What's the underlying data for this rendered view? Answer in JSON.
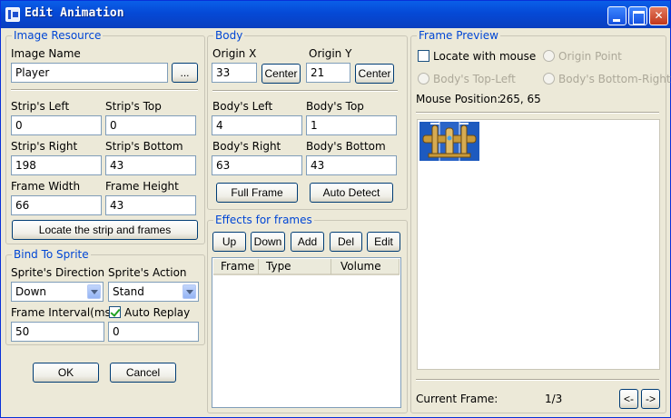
{
  "window": {
    "title": "Edit Animation"
  },
  "image_resource": {
    "group_label": "Image Resource",
    "image_name_label": "Image Name",
    "image_name_value": "Player",
    "browse_label": "...",
    "strip_left_label": "Strip's Left",
    "strip_left_value": "0",
    "strip_top_label": "Strip's Top",
    "strip_top_value": "0",
    "strip_right_label": "Strip's Right",
    "strip_right_value": "198",
    "strip_bottom_label": "Strip's Bottom",
    "strip_bottom_value": "43",
    "frame_width_label": "Frame Width",
    "frame_width_value": "66",
    "frame_height_label": "Frame Height",
    "frame_height_value": "43",
    "locate_button": "Locate the strip and frames"
  },
  "bind_to_sprite": {
    "group_label": "Bind To Sprite",
    "direction_label": "Sprite's Direction",
    "direction_value": "Down",
    "action_label": "Sprite's Action",
    "action_value": "Stand",
    "interval_label": "Frame Interval(ms)",
    "interval_value": "50",
    "auto_replay_label": "Auto Replay",
    "auto_replay_checked": true,
    "auto_replay_value": "0"
  },
  "dialog_buttons": {
    "ok": "OK",
    "cancel": "Cancel"
  },
  "body": {
    "group_label": "Body",
    "origin_x_label": "Origin X",
    "origin_x_value": "33",
    "origin_y_label": "Origin Y",
    "origin_y_value": "21",
    "center_label": "Center",
    "body_left_label": "Body's Left",
    "body_left_value": "4",
    "body_top_label": "Body's Top",
    "body_top_value": "1",
    "body_right_label": "Body's Right",
    "body_right_value": "63",
    "body_bottom_label": "Body's Bottom",
    "body_bottom_value": "43",
    "full_frame_button": "Full Frame",
    "auto_detect_button": "Auto Detect"
  },
  "effects": {
    "group_label": "Effects for frames",
    "buttons": {
      "up": "Up",
      "down": "Down",
      "add": "Add",
      "del": "Del",
      "edit": "Edit"
    },
    "columns": [
      "Frame",
      "Type",
      "Volume"
    ]
  },
  "frame_preview": {
    "group_label": "Frame Preview",
    "locate_with_mouse_label": "Locate with mouse",
    "origin_point_label": "Origin Point",
    "body_top_left_label": "Body's Top-Left",
    "body_bottom_right_label": "Body's Bottom-Right",
    "mouse_position_label": "Mouse Position:",
    "mouse_position_value": "265, 65",
    "current_frame_label": "Current Frame:",
    "current_frame_value": "1/3",
    "prev_label": "<-",
    "next_label": "->"
  }
}
